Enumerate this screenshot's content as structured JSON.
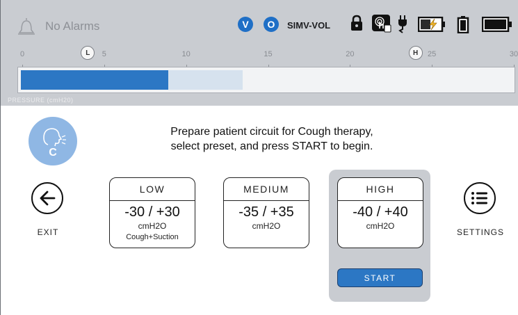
{
  "status": {
    "alarm_text": "No Alarms",
    "mode_badges": [
      "V",
      "O"
    ],
    "mode": "SIMV-VOL",
    "icons": [
      "bell-icon",
      "lock-icon",
      "touch-lock-icon",
      "ac-plug-icon",
      "battery-charging-icon",
      "battery-small-icon",
      "battery-full-icon"
    ]
  },
  "scale": {
    "tick_labels": [
      "0",
      "5",
      "10",
      "15",
      "20",
      "25",
      "30"
    ],
    "tick_values": [
      0,
      5,
      10,
      15,
      20,
      25,
      30
    ],
    "low_marker": "L",
    "high_marker": "H",
    "low_marker_value": 4,
    "high_marker_value": 24,
    "range_max": 30,
    "current_pressure": 9,
    "range_end": 13.5,
    "label": "PRESSURE (cmH20)"
  },
  "therapy": {
    "letter": "C",
    "instruction_line1": "Prepare patient circuit for Cough therapy,",
    "instruction_line2": "select preset, and press START to begin."
  },
  "controls": {
    "exit_label": "EXIT",
    "settings_label": "SETTINGS",
    "start_label": "START"
  },
  "presets": [
    {
      "name": "LOW",
      "range": "-30 / +30",
      "unit": "cmH2O",
      "note": "Cough+Suction"
    },
    {
      "name": "MEDIUM",
      "range": "-35 / +35",
      "unit": "cmH2O"
    },
    {
      "name": "HIGH",
      "range": "-40 / +40",
      "unit": "cmH2O"
    }
  ],
  "selected_preset": "HIGH",
  "colors": {
    "accent": "#2c77c4",
    "status_bar": "#c9ccd1",
    "avatar": "#8fb7e4"
  }
}
